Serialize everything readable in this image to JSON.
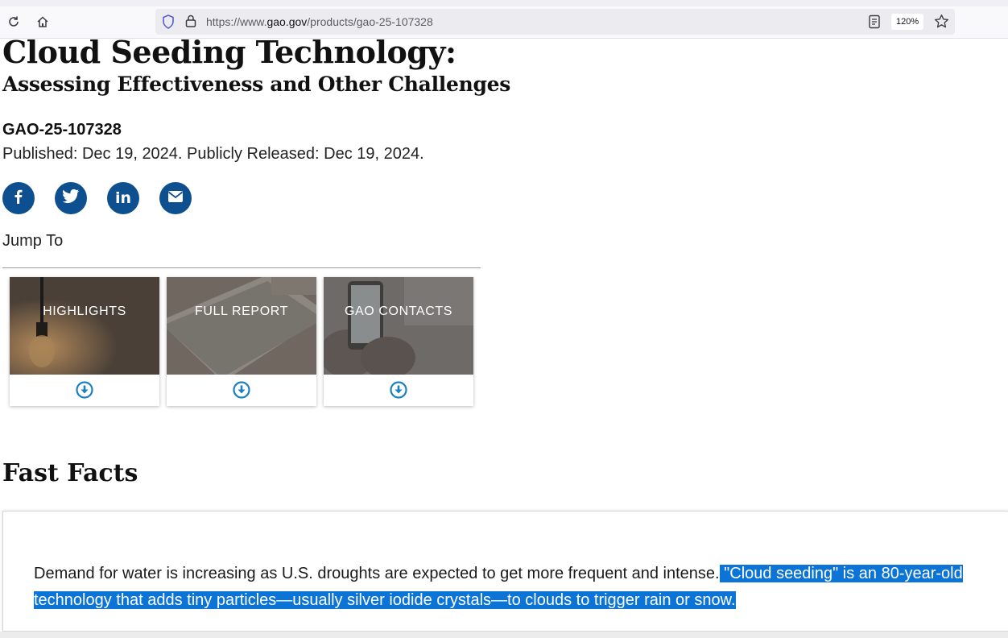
{
  "browser": {
    "url_prefix": "https://www.",
    "url_host": "gao.gov",
    "url_path": "/products/gao-25-107328",
    "zoom": "120%"
  },
  "page": {
    "title": "Cloud Seeding Technology:",
    "subtitle": "Assessing Effectiveness and Other Challenges",
    "report_id": "GAO-25-107328",
    "published": "Published: Dec 19, 2024. Publicly Released: Dec 19, 2024.",
    "social": [
      {
        "icon": "facebook-icon"
      },
      {
        "icon": "twitter-icon"
      },
      {
        "icon": "linkedin-icon"
      },
      {
        "icon": "email-icon"
      }
    ],
    "jump_to": "Jump To",
    "cards": [
      {
        "label": "HIGHLIGHTS"
      },
      {
        "label": "FULL REPORT"
      },
      {
        "label": "GAO CONTACTS"
      }
    ],
    "fast_facts_heading": "Fast Facts",
    "fast_facts_plain": "Demand for water is increasing as U.S. droughts are expected to get more frequent and intense.",
    "fast_facts_selected": " \"Cloud seeding\" is an 80-year-old technology that adds tiny particles—usually silver iodide crystals—to clouds to trigger rain or snow."
  },
  "colors": {
    "brand_blue": "#0e4f8f",
    "selection": "#0b74d6"
  }
}
